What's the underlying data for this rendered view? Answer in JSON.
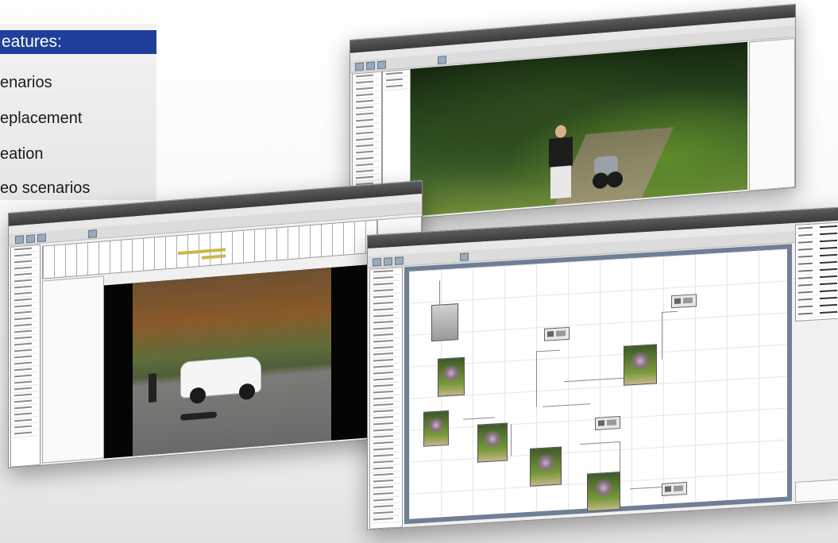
{
  "slide": {
    "header": "eatures:",
    "features": [
      "enarios",
      "eplacement",
      "eation",
      "eo scenarios"
    ]
  },
  "colors": {
    "slide_header": "#1f3f9a",
    "titlebar": "#3a3a3a",
    "canvas_frame": "#6f7f95"
  },
  "windows": [
    {
      "name": "video-scene-window",
      "content": "forest path with person and motorcycle"
    },
    {
      "name": "timeline-window",
      "content": "parking lot scene with car"
    },
    {
      "name": "graph-editor-window",
      "content": "node graph with video thumbnails"
    }
  ],
  "icons": [
    "toolbar-button-icon",
    "video-thumbnail-icon",
    "node-icon"
  ]
}
